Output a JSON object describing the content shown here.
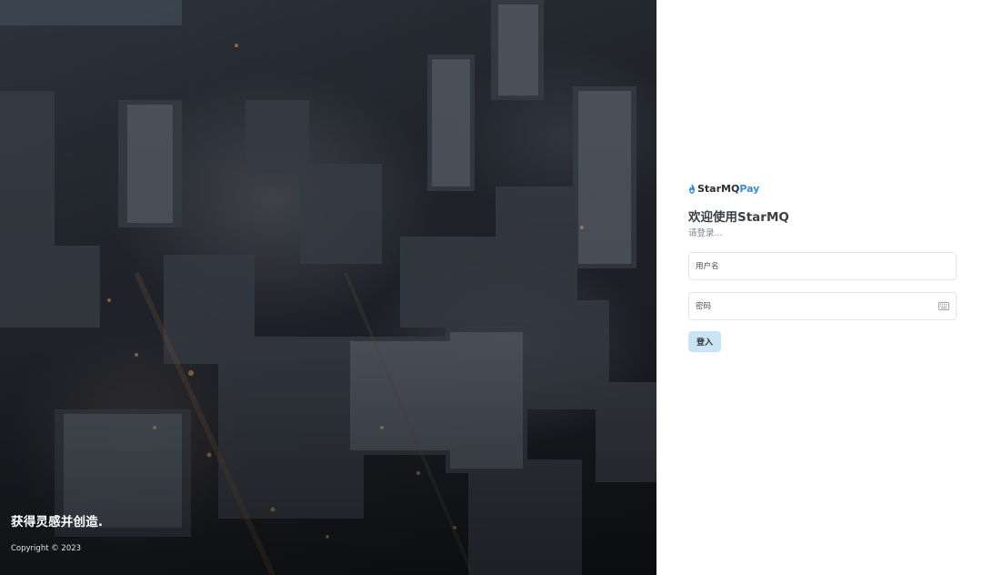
{
  "hero": {
    "tagline": "获得灵感并创造.",
    "copyright": "Copyright © 2023"
  },
  "brand": {
    "name_part1": "StarMQ",
    "name_part2": "Pay",
    "icon": "flame-icon",
    "accent_color": "#2f8fd8"
  },
  "login": {
    "welcome": "欢迎使用StarMQ",
    "subtitle": "请登录...",
    "username_placeholder": "用户名",
    "password_placeholder": "密码",
    "password_icon": "keyboard-icon",
    "submit_label": "登入",
    "submit_color": "#c9e5f5"
  }
}
